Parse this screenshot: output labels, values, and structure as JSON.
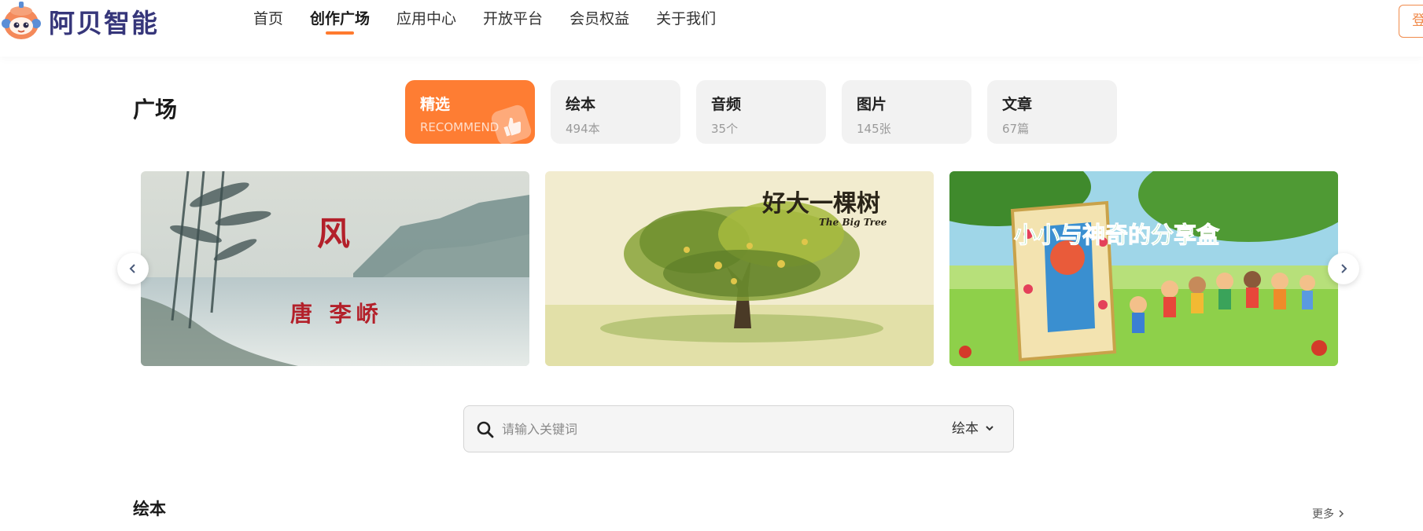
{
  "logo": {
    "text": "阿贝智能",
    "icon": "robot-mascot-icon"
  },
  "nav": {
    "items": [
      {
        "label": "首页",
        "active": false
      },
      {
        "label": "创作广场",
        "active": true
      },
      {
        "label": "应用中心",
        "active": false
      },
      {
        "label": "开放平台",
        "active": false
      },
      {
        "label": "会员权益",
        "active": false
      },
      {
        "label": "关于我们",
        "active": false
      }
    ],
    "login_label": "登"
  },
  "plaza": {
    "title": "广场",
    "categories": [
      {
        "title": "精选",
        "sub": "RECOMMEND",
        "active": true
      },
      {
        "title": "绘本",
        "sub": "494本",
        "active": false
      },
      {
        "title": "音频",
        "sub": "35个",
        "active": false
      },
      {
        "title": "图片",
        "sub": "145张",
        "active": false
      },
      {
        "title": "文章",
        "sub": "67篇",
        "active": false
      }
    ]
  },
  "carousel": {
    "slides": [
      {
        "title": "风",
        "subtitle": "唐 李峤"
      },
      {
        "title": "好大一棵树",
        "subtitle": "The Big Tree"
      },
      {
        "title": "小小与神奇的分享盒",
        "subtitle": ""
      }
    ],
    "prev_icon": "chevron-left-icon",
    "next_icon": "chevron-right-icon"
  },
  "search": {
    "placeholder": "请输入关键词",
    "value": "",
    "type_selected": "绘本"
  },
  "section": {
    "title": "绘本",
    "more_label": "更多"
  },
  "colors": {
    "accent": "#fe7d33",
    "logo_text": "#36367a",
    "card_bg": "#f2f2f2"
  }
}
